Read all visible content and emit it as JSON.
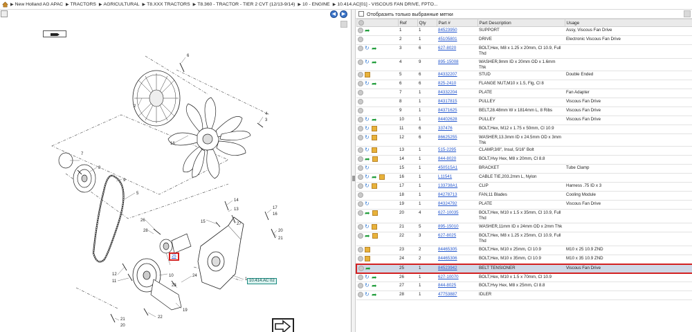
{
  "breadcrumbs": [
    "New Holland AG APAC",
    "TRACTORS",
    "AGRICULTURAL",
    "T8.XXX TRACTORS",
    "T8.360 - TRACTOR - TIER 2 CVT (12/13-9/14)",
    "10 - ENGINE",
    "10.414.AC[01] - VISCOUS FAN DRIVE, FPTO..."
  ],
  "filter_label": "Отобразить только выбранные метки",
  "columns": [
    "Ref",
    "Qty",
    "Part #",
    "Part Description",
    "Usage"
  ],
  "rows": [
    {
      "icons": [
        "circ",
        "bin"
      ],
      "ref": "1",
      "qty": "1",
      "part": "84523950",
      "desc": "SUPPORT",
      "usage": "Assy, Viscous Fan Drive"
    },
    {
      "icons": [
        "circ"
      ],
      "ref": "2",
      "qty": "1",
      "part": "45105801",
      "desc": "DRIVE",
      "usage": "Electronic Viscous Fan Drive"
    },
    {
      "icons": [
        "circ",
        "rot",
        "bin"
      ],
      "ref": "3",
      "qty": "6",
      "part": "627-8020",
      "desc": "BOLT,Hex, M8 x 1.25 x 20mm, Cl 10.9, Full Thd",
      "usage": ""
    },
    {
      "icons": [
        "circ",
        "rot",
        "bin"
      ],
      "ref": "4",
      "qty": "9",
      "part": "895-15008",
      "desc": "WASHER,9mm ID x 20mm OD x 1.6mm Thk",
      "usage": ""
    },
    {
      "icons": [
        "circ",
        "box"
      ],
      "ref": "5",
      "qty": "6",
      "part": "84332207",
      "desc": "STUD",
      "usage": "Double Ended"
    },
    {
      "icons": [
        "circ",
        "rot",
        "bin"
      ],
      "ref": "6",
      "qty": "6",
      "part": "825-2410",
      "desc": "FLANGE NUT,M10 x 1.5, Flg, Cl 8",
      "usage": ""
    },
    {
      "icons": [
        "circ"
      ],
      "ref": "7",
      "qty": "1",
      "part": "84332204",
      "desc": "PLATE",
      "usage": "Fan Adapter"
    },
    {
      "icons": [
        "circ"
      ],
      "ref": "8",
      "qty": "1",
      "part": "84317815",
      "desc": "PULLEY",
      "usage": "Viscous Fan Drive"
    },
    {
      "icons": [
        "circ"
      ],
      "ref": "9",
      "qty": "1",
      "part": "84371625",
      "desc": "BELT,28.48mm W x 1814mm L, 8 Ribs",
      "usage": "Viscous Fan Drive"
    },
    {
      "icons": [
        "circ",
        "rot",
        "bin"
      ],
      "ref": "10",
      "qty": "1",
      "part": "84402628",
      "desc": "PULLEY",
      "usage": "Viscous Fan Drive"
    },
    {
      "icons": [
        "circ",
        "rot",
        "box"
      ],
      "ref": "11",
      "qty": "6",
      "part": "337476",
      "desc": "BOLT,Hex, M12 x 1.75 x 50mm, Cl 10.9",
      "usage": ""
    },
    {
      "icons": [
        "circ",
        "rot",
        "box"
      ],
      "ref": "12",
      "qty": "6",
      "part": "86625255",
      "desc": "WASHER,13.3mm ID x 24.5mm OD x 3mm Thk",
      "usage": ""
    },
    {
      "icons": [
        "circ",
        "rot",
        "box"
      ],
      "ref": "13",
      "qty": "1",
      "part": "515-2295",
      "desc": "CLAMP,3/8\", Insul, 5/16\" Bolt",
      "usage": ""
    },
    {
      "icons": [
        "circ",
        "bin",
        "box"
      ],
      "ref": "14",
      "qty": "1",
      "part": "844-8020",
      "desc": "BOLT,Hvy Hex, M8 x 20mm, Cl 8.8",
      "usage": ""
    },
    {
      "icons": [
        "circ",
        "rot"
      ],
      "ref": "15",
      "qty": "1",
      "part": "450515A1",
      "desc": "BRACKET",
      "usage": "Tube Clamp"
    },
    {
      "icons": [
        "circ",
        "rot",
        "bin",
        "box"
      ],
      "ref": "16",
      "qty": "1",
      "part": "L11541",
      "desc": "CABLE TIE,203.2mm L, Nylon",
      "usage": ""
    },
    {
      "icons": [
        "circ",
        "rot",
        "box"
      ],
      "ref": "17",
      "qty": "1",
      "part": "133738A1",
      "desc": "CLIP",
      "usage": "Harness .75 ID x 3"
    },
    {
      "icons": [
        "circ"
      ],
      "ref": "18",
      "qty": "1",
      "part": "84278713",
      "desc": "FAN,11 Blades",
      "usage": "Cooling Module"
    },
    {
      "icons": [
        "circ",
        "rot"
      ],
      "ref": "19",
      "qty": "1",
      "part": "84324792",
      "desc": "PLATE",
      "usage": "Viscous Fan Drive"
    },
    {
      "icons": [
        "circ",
        "bin",
        "box"
      ],
      "ref": "20",
      "qty": "4",
      "part": "627-10035",
      "desc": "BOLT,Hex, M10 x 1.5 x 35mm, Cl 10.9, Full Thd",
      "usage": ""
    },
    {
      "icons": [
        "circ",
        "rot",
        "box"
      ],
      "ref": "21",
      "qty": "5",
      "part": "895-15010",
      "desc": "WASHER,11mm ID x 24mm OD x 2mm Thk",
      "usage": ""
    },
    {
      "icons": [
        "circ",
        "bin",
        "box"
      ],
      "ref": "22",
      "qty": "3",
      "part": "627-8025",
      "desc": "BOLT,Hex, M8 x 1.25 x 25mm, Cl 10.9, Full Thd",
      "usage": ""
    },
    {
      "icons": [
        "circ",
        "box"
      ],
      "ref": "23",
      "qty": "2",
      "part": "84465305",
      "desc": "BOLT,Hex, M10 x 25mm, Cl 10.9",
      "usage": "M10 x 25 10.9 ZND"
    },
    {
      "icons": [
        "circ",
        "box"
      ],
      "ref": "24",
      "qty": "2",
      "part": "84465306",
      "desc": "BOLT,Hex, M10 x 35mm, Cl 10.9",
      "usage": "M10 x 35 10.9 ZND"
    },
    {
      "icons": [
        "circ",
        "bin"
      ],
      "ref": "25",
      "qty": "1",
      "part": "84523942",
      "desc": "BELT TENSIONER",
      "usage": "Viscous Fan Drive",
      "selected": true
    },
    {
      "icons": [
        "circ",
        "rot",
        "bin"
      ],
      "ref": "26",
      "qty": "1",
      "part": "627-10070",
      "desc": "BOLT,Hex, M10 x 1.5 x 70mm, Cl 10.9",
      "usage": ""
    },
    {
      "icons": [
        "circ",
        "rot",
        "bin"
      ],
      "ref": "27",
      "qty": "1",
      "part": "844-8025",
      "desc": "BOLT,Hvy Hex, M8 x 25mm, Cl 8.8",
      "usage": ""
    },
    {
      "icons": [
        "circ",
        "rot",
        "bin"
      ],
      "ref": "28",
      "qty": "1",
      "part": "47753887",
      "desc": "IDLER",
      "usage": ""
    }
  ],
  "diagram": {
    "ref_label": "10.414.AC 02",
    "selected_callout": "25",
    "callouts": [
      "1",
      "2",
      "3",
      "4",
      "5",
      "6",
      "7",
      "8",
      "9",
      "10",
      "11",
      "12",
      "13",
      "14",
      "15",
      "16",
      "17",
      "18",
      "19",
      "20",
      "21",
      "22",
      "23",
      "24",
      "26",
      "27",
      "28"
    ]
  }
}
